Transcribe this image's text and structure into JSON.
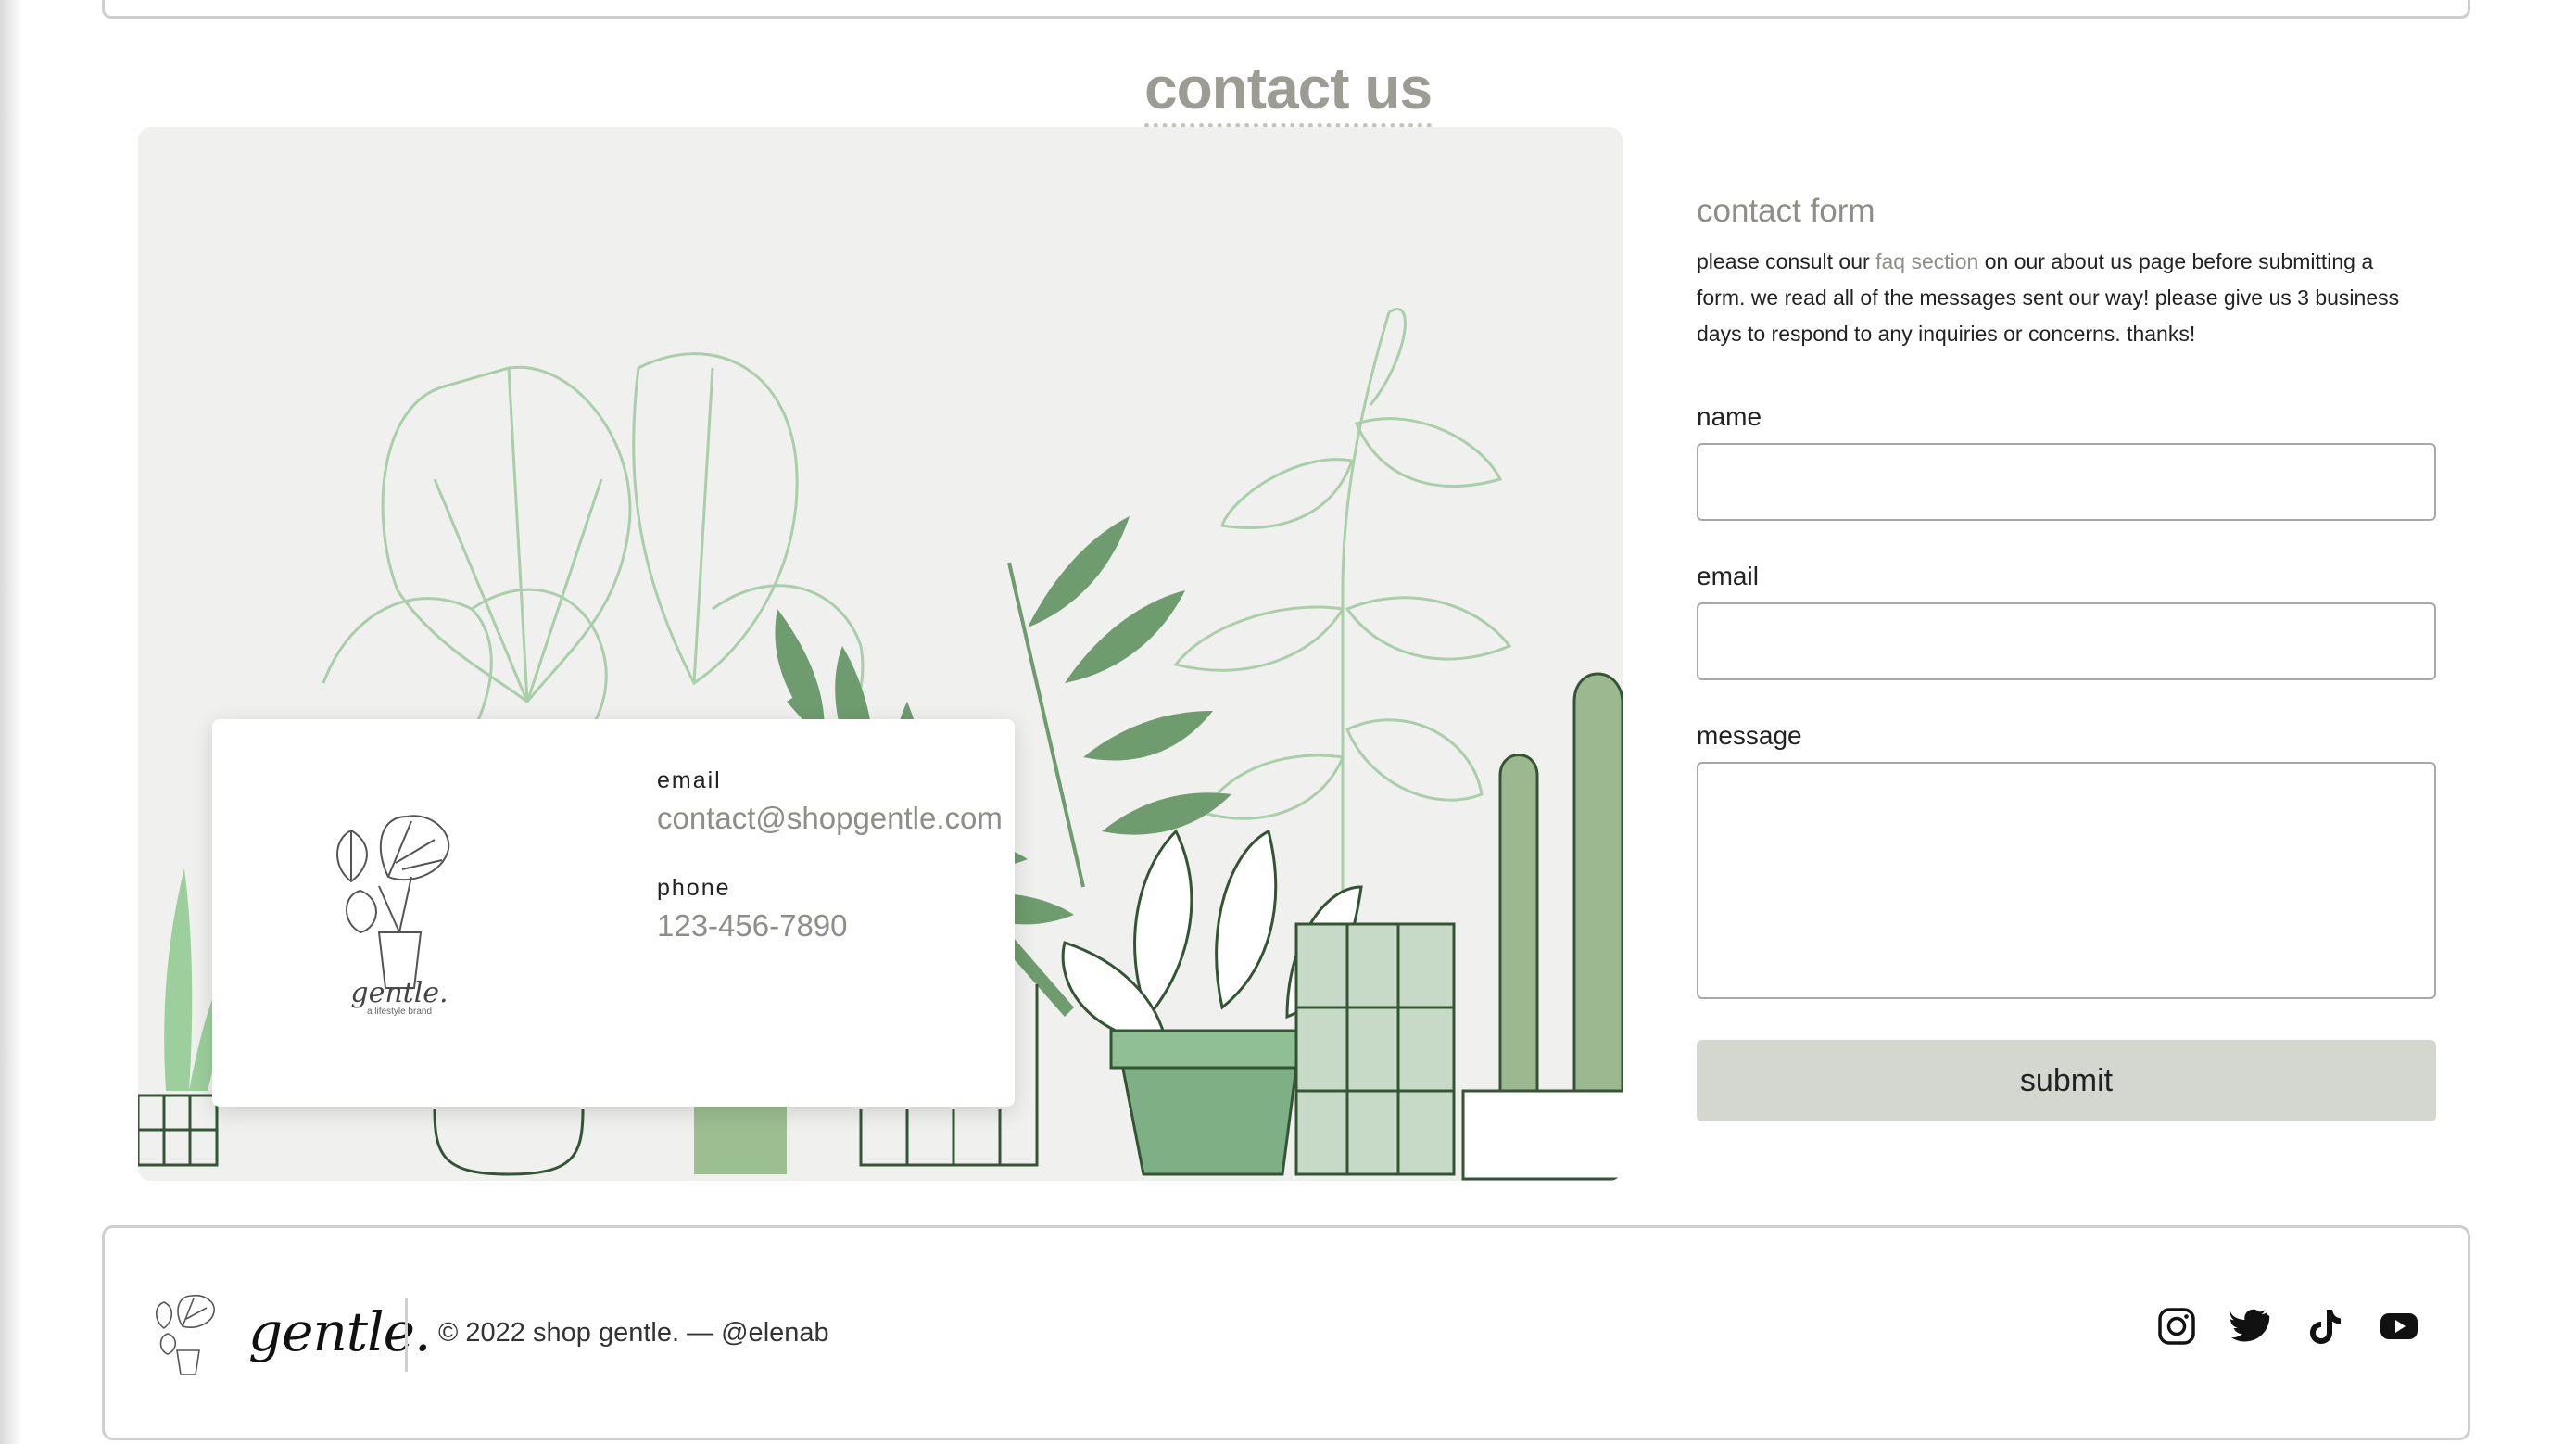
{
  "page": {
    "title": "contact us"
  },
  "card": {
    "brand": "gentle.",
    "tagline": "a lifestyle brand",
    "email_label": "email",
    "email_value": "contact@shopgentle.com",
    "phone_label": "phone",
    "phone_value": "123-456-7890"
  },
  "form": {
    "title": "contact form",
    "desc_before": "please consult our ",
    "faq_link": "faq section",
    "desc_after": " on our about us page before submitting a form. we read all of the messages sent our way! please give us 3 business days to respond to any inquiries or concerns. thanks!",
    "name_label": "name",
    "email_label": "email",
    "message_label": "message",
    "submit_label": "submit"
  },
  "footer": {
    "brand": "gentle.",
    "copyright": "© 2022 shop gentle. — @elenab",
    "social": [
      "instagram-icon",
      "twitter-icon",
      "tiktok-icon",
      "youtube-icon"
    ]
  },
  "colors": {
    "accent": "#8e8e86",
    "leaf_dark": "#6e9c6e",
    "leaf_light": "#a9cfa9",
    "submit_bg": "#d4d6d0"
  }
}
